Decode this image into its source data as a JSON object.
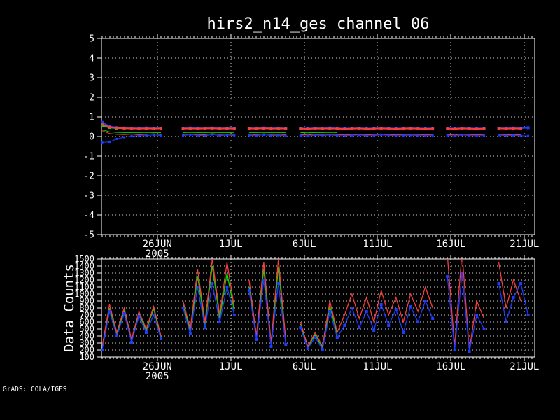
{
  "footer": {
    "attribution": "GrADS: COLA/IGES"
  },
  "colors": {
    "background": "#000000",
    "foreground": "#ffffff",
    "grid": "#cccccc",
    "red": "#fa3c3c",
    "green": "#00dc00",
    "blue": "#1e3cff"
  },
  "chart_data": [
    {
      "id": "top-chart",
      "type": "line",
      "title": "hirs2_n14_ges channel 06",
      "ylabel": "",
      "ylim": [
        -5,
        5
      ],
      "yticks": [
        5,
        4,
        3,
        2,
        1,
        0,
        -1,
        -2,
        -3,
        -4,
        -5
      ],
      "xlim": [
        0.2,
        29.7
      ],
      "x_unit": "days, 0 = 22JUN2005",
      "xticks": [
        {
          "x": 4,
          "label": "26JUN",
          "sublabel": "2005"
        },
        {
          "x": 9,
          "label": "1JUL"
        },
        {
          "x": 14,
          "label": "6JUL"
        },
        {
          "x": 19,
          "label": "11JUL"
        },
        {
          "x": 24,
          "label": "16JUL"
        },
        {
          "x": 29,
          "label": "21JUL"
        }
      ],
      "grid": "dotted",
      "x": [
        0.25,
        0.75,
        1.25,
        1.75,
        2.25,
        2.75,
        3.25,
        3.75,
        4.25,
        4.75,
        5.25,
        5.75,
        6.25,
        6.75,
        7.25,
        7.75,
        8.25,
        8.75,
        9.25,
        9.75,
        10.25,
        10.75,
        11.25,
        11.75,
        12.25,
        12.75,
        13.25,
        13.75,
        14.25,
        14.75,
        15.25,
        15.75,
        16.25,
        16.75,
        17.25,
        17.75,
        18.25,
        18.75,
        19.25,
        19.75,
        20.25,
        20.75,
        21.25,
        21.75,
        22.25,
        22.75,
        23.25,
        23.75,
        24.25,
        24.75,
        25.25,
        25.75,
        26.25,
        26.75,
        27.25,
        27.75,
        28.25,
        28.75,
        29.25
      ],
      "series": [
        {
          "name": "green-stdev",
          "color": "green",
          "marker": "square",
          "marker_size": 4,
          "width": 2,
          "values": [
            0.55,
            0.46,
            0.43,
            0.42,
            0.41,
            0.42,
            0.43,
            0.41,
            0.42,
            null,
            null,
            0.42,
            0.43,
            0.42,
            0.41,
            0.43,
            0.41,
            0.42,
            0.41,
            null,
            0.42,
            0.41,
            0.43,
            0.41,
            0.42,
            0.41,
            null,
            0.41,
            0.4,
            0.42,
            0.41,
            0.42,
            0.41,
            null,
            null,
            null,
            null,
            null,
            null,
            null,
            null,
            null,
            null,
            null,
            null,
            null,
            null,
            null,
            null,
            null,
            null,
            null,
            null,
            null,
            null,
            null,
            null,
            null,
            null
          ]
        },
        {
          "name": "blue-stdev",
          "color": "blue",
          "marker": "square",
          "marker_size": 4,
          "width": 2,
          "values": [
            0.72,
            0.52,
            0.46,
            0.44,
            0.43,
            0.42,
            0.44,
            0.42,
            0.43,
            null,
            null,
            0.42,
            0.44,
            0.43,
            0.42,
            0.44,
            0.42,
            0.43,
            0.42,
            null,
            0.43,
            0.42,
            0.44,
            0.42,
            0.43,
            0.42,
            null,
            0.42,
            0.41,
            0.43,
            0.42,
            0.44,
            0.42,
            0.41,
            0.42,
            0.43,
            0.41,
            0.42,
            0.43,
            0.42,
            0.41,
            0.42,
            0.43,
            0.42,
            0.41,
            0.42,
            null,
            0.42,
            0.41,
            0.43,
            0.42,
            0.41,
            0.42,
            null,
            0.43,
            0.42,
            0.44,
            0.43,
            0.45
          ]
        },
        {
          "name": "red-stdev",
          "color": "red",
          "marker": "circle",
          "marker_size": 4,
          "width": 2,
          "values": [
            0.62,
            0.48,
            0.44,
            0.42,
            0.41,
            0.4,
            0.41,
            0.4,
            0.41,
            null,
            null,
            0.4,
            0.41,
            0.4,
            0.41,
            0.42,
            0.4,
            0.41,
            0.4,
            null,
            0.41,
            0.4,
            0.42,
            0.4,
            0.41,
            0.4,
            null,
            0.4,
            0.39,
            0.41,
            0.4,
            0.41,
            0.4,
            0.39,
            0.4,
            0.41,
            0.39,
            0.4,
            0.41,
            0.4,
            0.39,
            0.4,
            0.41,
            0.4,
            0.39,
            0.4,
            null,
            0.4,
            0.39,
            0.41,
            0.4,
            0.39,
            0.4,
            null,
            0.41,
            0.4,
            0.41,
            0.4,
            null
          ]
        },
        {
          "name": "green-mean",
          "color": "green",
          "marker": null,
          "width": 1,
          "values": [
            0.35,
            0.24,
            0.21,
            0.2,
            0.2,
            0.2,
            0.21,
            0.2,
            0.2,
            null,
            null,
            0.2,
            0.21,
            0.2,
            0.2,
            0.21,
            0.2,
            0.2,
            0.2,
            null,
            0.2,
            0.2,
            0.21,
            0.2,
            0.2,
            0.2,
            null,
            0.2,
            0.19,
            0.2,
            0.2,
            0.21,
            0.2,
            null,
            null,
            null,
            null,
            null,
            null,
            null,
            null,
            null,
            null,
            null,
            null,
            null,
            null,
            null,
            null,
            null,
            null,
            null,
            null,
            null,
            null,
            null,
            null,
            null,
            null
          ]
        },
        {
          "name": "red-mean",
          "color": "red",
          "marker": null,
          "width": 1,
          "values": [
            0.3,
            0.15,
            0.11,
            0.1,
            0.12,
            0.09,
            0.11,
            0.14,
            0.1,
            null,
            null,
            0.1,
            0.13,
            0.1,
            0.09,
            0.15,
            0.1,
            0.12,
            0.1,
            null,
            0.11,
            0.09,
            0.14,
            0.1,
            0.11,
            0.09,
            null,
            0.1,
            0.08,
            0.11,
            0.1,
            0.12,
            0.1,
            0.09,
            0.1,
            0.11,
            0.09,
            0.1,
            0.12,
            0.1,
            0.09,
            0.1,
            0.11,
            0.1,
            0.09,
            0.1,
            null,
            0.1,
            0.08,
            0.12,
            0.1,
            0.09,
            0.1,
            null,
            0.11,
            0.09,
            0.1,
            0.09,
            null
          ]
        },
        {
          "name": "blue-mean",
          "color": "blue",
          "marker": "square",
          "marker_size": 3,
          "width": 1,
          "values": [
            -0.3,
            -0.27,
            -0.12,
            -0.04,
            0.02,
            0.04,
            0.05,
            0.08,
            0.05,
            null,
            null,
            0.05,
            0.09,
            0.06,
            0.04,
            0.1,
            0.05,
            0.07,
            0.05,
            null,
            0.06,
            0.04,
            0.09,
            0.05,
            0.06,
            0.04,
            null,
            0.05,
            0.03,
            0.07,
            0.05,
            0.08,
            0.05,
            0.04,
            0.06,
            0.08,
            0.04,
            0.05,
            0.08,
            0.06,
            0.04,
            0.05,
            0.07,
            0.05,
            0.04,
            0.05,
            null,
            0.06,
            0.03,
            0.08,
            0.05,
            0.04,
            0.05,
            null,
            0.07,
            0.04,
            0.06,
            0.04,
            0.03
          ]
        }
      ]
    },
    {
      "id": "bottom-chart",
      "type": "line",
      "title": "",
      "ylabel": "Data Counts",
      "ylim": [
        100,
        1500
      ],
      "yticks": [
        1500,
        1400,
        1300,
        1200,
        1100,
        1000,
        900,
        800,
        700,
        600,
        500,
        400,
        300,
        200,
        100
      ],
      "xlim": [
        0.2,
        29.7
      ],
      "x_unit": "days, 0 = 22JUN2005",
      "xticks": [
        {
          "x": 4,
          "label": "26JUN",
          "sublabel": "2005"
        },
        {
          "x": 9,
          "label": "1JUL"
        },
        {
          "x": 14,
          "label": "6JUL"
        },
        {
          "x": 19,
          "label": "11JUL"
        },
        {
          "x": 24,
          "label": "16JUL"
        },
        {
          "x": 29,
          "label": "21JUL"
        }
      ],
      "grid": "dotted",
      "x": [
        0.25,
        0.75,
        1.25,
        1.75,
        2.25,
        2.75,
        3.25,
        3.75,
        4.25,
        4.75,
        5.25,
        5.75,
        6.25,
        6.75,
        7.25,
        7.75,
        8.25,
        8.75,
        9.25,
        9.75,
        10.25,
        10.75,
        11.25,
        11.75,
        12.25,
        12.75,
        13.25,
        13.75,
        14.25,
        14.75,
        15.25,
        15.75,
        16.25,
        16.75,
        17.25,
        17.75,
        18.25,
        18.75,
        19.25,
        19.75,
        20.25,
        20.75,
        21.25,
        21.75,
        22.25,
        22.75,
        23.25,
        23.75,
        24.25,
        24.75,
        25.25,
        25.75,
        26.25,
        26.75,
        27.25,
        27.75,
        28.25,
        28.75,
        29.25
      ],
      "series": [
        {
          "name": "green-counts",
          "color": "green",
          "marker": null,
          "width": 1.3,
          "values": [
            230,
            800,
            430,
            760,
            330,
            720,
            480,
            790,
            380,
            null,
            null,
            850,
            470,
            1250,
            560,
            1400,
            650,
            1300,
            750,
            null,
            1100,
            380,
            1350,
            280,
            1380,
            320,
            null,
            570,
            240,
            420,
            230,
            830,
            420,
            null,
            null,
            null,
            null,
            null,
            null,
            null,
            null,
            null,
            null,
            null,
            null,
            null,
            null,
            null,
            null,
            null,
            null,
            null,
            null,
            null,
            null,
            null,
            null,
            null,
            null
          ]
        },
        {
          "name": "red-counts",
          "color": "red",
          "marker": null,
          "width": 1.3,
          "values": [
            250,
            850,
            450,
            800,
            350,
            750,
            500,
            820,
            400,
            null,
            null,
            900,
            500,
            1350,
            600,
            1500,
            700,
            1450,
            800,
            null,
            1200,
            400,
            1450,
            300,
            1500,
            350,
            null,
            600,
            250,
            450,
            250,
            900,
            450,
            700,
            1000,
            650,
            950,
            600,
            1050,
            700,
            950,
            600,
            1000,
            750,
            1100,
            800,
            null,
            1550,
            250,
            1600,
            200,
            900,
            650,
            null,
            1450,
            800,
            1200,
            900,
            null
          ]
        },
        {
          "name": "blue-counts",
          "color": "blue",
          "marker": "square",
          "marker_size": 4,
          "width": 1.3,
          "values": [
            200,
            750,
            400,
            720,
            310,
            680,
            450,
            700,
            360,
            null,
            null,
            800,
            430,
            1100,
            520,
            1150,
            600,
            1100,
            700,
            null,
            1050,
            350,
            1200,
            250,
            1150,
            280,
            null,
            520,
            220,
            380,
            210,
            750,
            380,
            550,
            800,
            520,
            750,
            480,
            850,
            550,
            780,
            450,
            820,
            600,
            900,
            650,
            null,
            1250,
            200,
            1300,
            180,
            700,
            500,
            null,
            1150,
            600,
            950,
            1150,
            700
          ]
        }
      ]
    }
  ]
}
